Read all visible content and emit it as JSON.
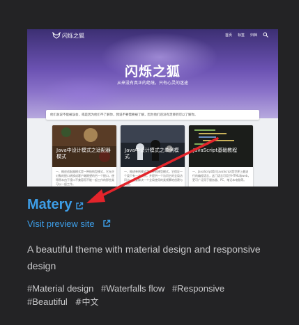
{
  "preview": {
    "site_name": "闪烁之狐",
    "nav": [
      "首页",
      "标签",
      "归档"
    ],
    "hero_title": "闪烁之狐",
    "hero_subtitle": "从来没有真正的绝境，只有心灵的迷途",
    "notice": "他们总说不能被误会，或是因为他们不了解你，我说不要需要被了解，因为他们还没有足够到可以了解你。",
    "posts": [
      {
        "title": "Java中设计模式之适配器模式",
        "excerpt": "一、概述适配器模式是一种结构型模式，它允许对象的接口转换成客户端期望的另一个接口，使得原本由于接口不兼容而不能一起工作的那些类可以一起工作。"
      },
      {
        "title": "Java中设计模式之单例模式",
        "excerpt": "一、概述单例模式是一种创建型模式，它保证一个类只有一个实例，并提供一个访问它的全局访问点，主要解决一个全局使用的类频繁地创建与销毁。"
      },
      {
        "title": "JavaScript基础教程",
        "excerpt": "一、JavaScript简介JavaScript是世界上最流行的编程语言，这门语言可用于HTML和web，更可广泛用于服务器、PC、笔记本电脑等。"
      }
    ]
  },
  "theme": {
    "name": "Matery",
    "preview_link": "Visit preview site",
    "description": "A beautiful theme with material design and responsive design",
    "tags": [
      "#Material design",
      "#Waterfalls flow",
      "#Responsive",
      "#Beautiful",
      "#中文"
    ]
  },
  "colors": {
    "background": "#232325",
    "link": "#3d9ee8",
    "text": "#c9c9cb",
    "arrow": "#e3242b"
  }
}
